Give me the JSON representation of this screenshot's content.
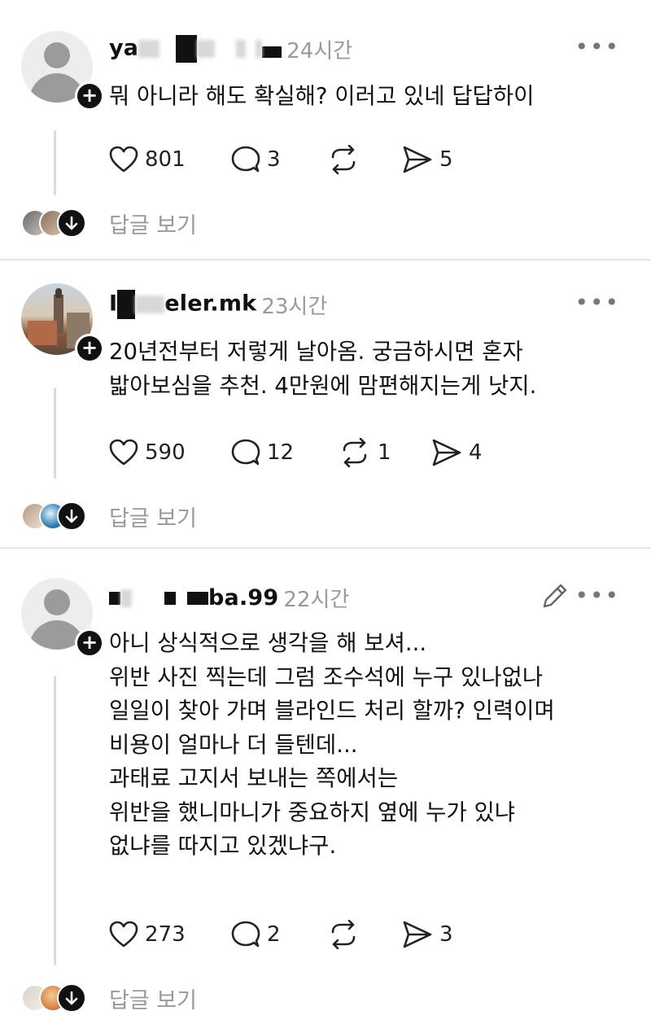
{
  "posts": [
    {
      "username_visible_start": "ya",
      "username_visible_end": "",
      "time": "24시간",
      "text": "뭐 아니라 해도 확실해? 이러고 있네 답답하이",
      "likes": "801",
      "comments": "3",
      "reposts": "",
      "shares": "5",
      "view_replies": "답글 보기"
    },
    {
      "username_visible_start": "I",
      "username_visible_end": "eler.mk",
      "time": "23시간",
      "text": "20년전부터 저렇게 날아옴. 궁금하시면 혼자\n밟아보심을 추천. 4만원에 맘편해지는게 낫지.",
      "likes": "590",
      "comments": "12",
      "reposts": "1",
      "shares": "4",
      "view_replies": "답글 보기"
    },
    {
      "username_visible_start": "",
      "username_visible_end": "ba.99",
      "time": "22시간",
      "text": "아니 상식적으로 생각을 해 보셔...\n위반 사진 찍는데 그럼 조수석에 누구 있나없나\n일일이 찾아 가며 블라인드 처리 할까? 인력이며\n비용이 얼마나 더 들텐데...\n과태료 고지서 보내는 쪽에서는\n위반을 했니마니가 중요하지 옆에 누가 있냐\n없냐를 따지고 있겠냐구.",
      "likes": "273",
      "comments": "2",
      "reposts": "",
      "shares": "3",
      "view_replies": "답글 보기"
    }
  ],
  "icons": {
    "more": "more-horizontal-icon",
    "plus": "plus-badge-icon",
    "like": "heart-icon",
    "comment": "comment-bubble-icon",
    "repost": "repost-icon",
    "share": "share-send-icon",
    "edit": "pencil-icon",
    "expand": "arrow-down-icon"
  },
  "colors": {
    "text": "#111111",
    "muted": "#9a9a9a",
    "divider": "#e6e6e6"
  }
}
